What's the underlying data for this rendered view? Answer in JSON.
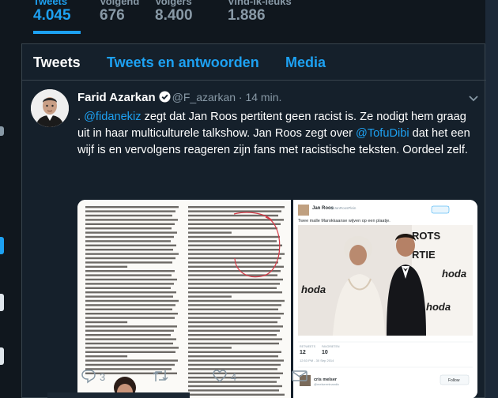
{
  "stats": [
    {
      "label": "Tweets",
      "value": "4.045",
      "active": true
    },
    {
      "label": "Volgend",
      "value": "676",
      "active": false
    },
    {
      "label": "Volgers",
      "value": "8.400",
      "active": false
    },
    {
      "label": "Vind-ik-leuks",
      "value": "1.886",
      "active": false
    }
  ],
  "tabs": [
    {
      "label": "Tweets",
      "active": true
    },
    {
      "label": "Tweets en antwoorden",
      "active": false
    },
    {
      "label": "Media",
      "active": false
    }
  ],
  "tweet": {
    "name": "Farid Azarkan",
    "handle": "@F_azarkan",
    "separator": "·",
    "time": "14 min.",
    "text_parts": [
      {
        "t": ". ",
        "mention": false
      },
      {
        "t": "@fidanekiz",
        "mention": true
      },
      {
        "t": " zegt dat Jan Roos pertitent geen racist is. Ze nodigt hem graag uit in haar multiculturele talkshow. Jan Roos zegt over ",
        "mention": false
      },
      {
        "t": "@TofuDibi",
        "mention": true
      },
      {
        "t": " dat het een wijf is en vervolgens reageren zijn fans met racistische teksten. Oordeel zelf.",
        "mention": false
      }
    ],
    "replies": "3",
    "retweets": "",
    "likes": "4"
  },
  "embedded_tweet": {
    "name": "Jan Roos",
    "handle": "@JanRoosPlein",
    "text": "Twee malle Marokkaanse wijven op een plaatje.",
    "retweets_label": "RETWEETS",
    "retweets": "12",
    "favs_label": "FAVORIETEN",
    "favs": "10",
    "time": "12:53 PM - 30 Sep 2014",
    "reply_name": "cris melser",
    "reply_handle": "@melserminandic",
    "follow_label": "Follow",
    "sign1": "hoda",
    "sign2": "ROTS",
    "sign3": "RTIE"
  },
  "colors": {
    "accent": "#1da1f2",
    "bg": "#10171e",
    "panel": "#15202b",
    "muted": "#8899a6"
  }
}
